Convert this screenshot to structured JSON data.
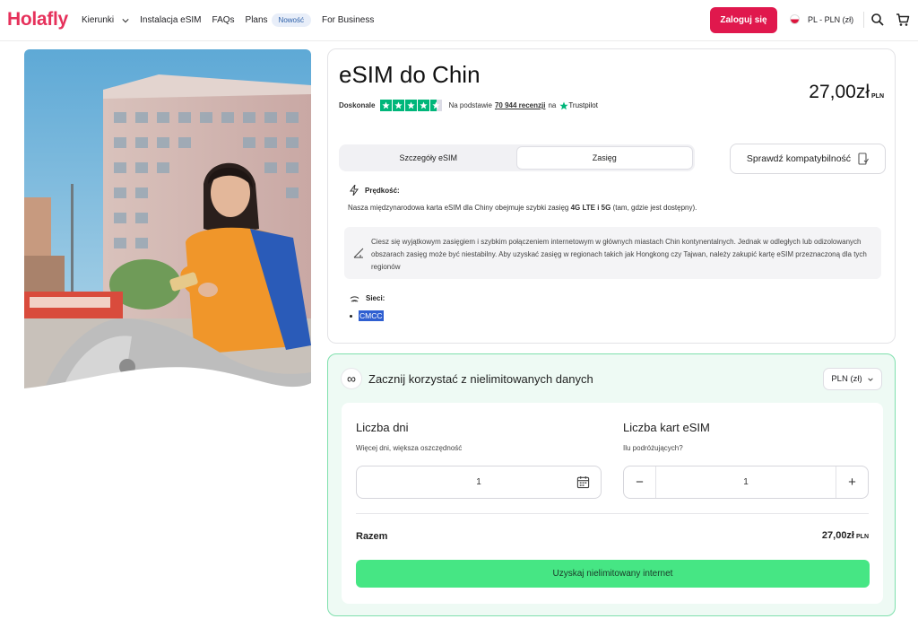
{
  "header": {
    "logo": "Holafly",
    "nav": [
      {
        "label": "Kierunki",
        "has_dropdown": true
      },
      {
        "label": "Instalacja eSIM"
      },
      {
        "label": "FAQs"
      },
      {
        "label": "Plans"
      },
      {
        "label": "For Business"
      }
    ],
    "new_badge": "Nowość",
    "login_label": "Zaloguj się",
    "language": "PL - PLN (zł)",
    "icons": [
      "search-icon",
      "cart-icon"
    ],
    "brand_color": "#e6315b"
  },
  "product": {
    "title": "eSIM do Chin",
    "rating_label": "Doskonale",
    "rating_stars": 4.5,
    "reviews_prefix": "Na podstawie",
    "reviews_count": "70 944 recenzji",
    "reviews_suffix": "na",
    "trustpilot": "Trustpilot",
    "price": "27,00zł",
    "price_currency": "PLN",
    "tabs": [
      "Szczegóły eSIM",
      "Zasięg"
    ],
    "active_tab": "Zasięg",
    "compat_button": "Sprawdź kompatybilność",
    "speed_heading": "Prędkość:",
    "speed_text_before": "Nasza międzynarodowa karta eSIM dla Chiny obejmuje szybki zasięg",
    "speed_text_bold": "4G LTE i 5G",
    "speed_text_after": "(tam, gdzie jest dostępny).",
    "notice_text": "Ciesz się wyjątkowym zasięgiem i szybkim połączeniem internetowym w głównych miastach Chin kontynentalnych. Jednak w odległych lub odizolowanych obszarach zasięg może być niestabilny. Aby uzyskać zasięg w regionach takich jak Hongkong czy Tajwan, należy zakupić kartę eSIM przeznaczoną dla tych regionów",
    "networks_heading": "Sieci:",
    "networks": [
      "CMCC"
    ]
  },
  "plan": {
    "heading": "Zacznij korzystać z nielimitowanych danych",
    "currency_select": "PLN (zł)",
    "days_label": "Liczba dni",
    "days_sub": "Więcej dni, większa oszczędność",
    "days_value": "1",
    "cards_label": "Liczba kart eSIM",
    "cards_sub": "Ilu podróżujących?",
    "cards_value": "1",
    "total_label": "Razem",
    "total_value": "27,00zł",
    "total_currency": "PLN",
    "cta": "Uzyskaj nielimitowany internet",
    "cta_color": "#46e684"
  }
}
